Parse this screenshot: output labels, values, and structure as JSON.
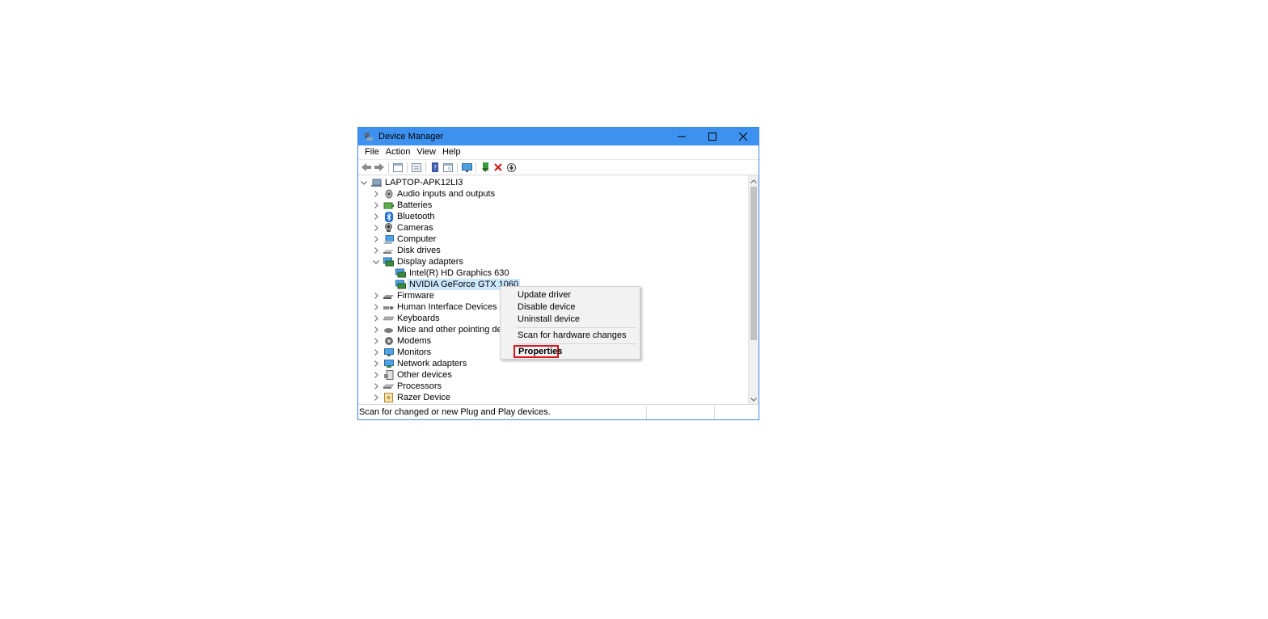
{
  "window": {
    "title": "Device Manager"
  },
  "menubar": {
    "items": [
      "File",
      "Action",
      "View",
      "Help"
    ]
  },
  "tree": {
    "root": "LAPTOP-APK12LI3",
    "categories": [
      "Audio inputs and outputs",
      "Batteries",
      "Bluetooth",
      "Cameras",
      "Computer",
      "Disk drives",
      "Display adapters",
      "Intel(R) HD Graphics 630",
      "NVIDIA GeForce GTX 1060",
      "Firmware",
      "Human Interface Devices",
      "Keyboards",
      "Mice and other pointing devices",
      "Modems",
      "Monitors",
      "Network adapters",
      "Other devices",
      "Processors",
      "Razer Device"
    ],
    "expanded": "Display adapters",
    "selected": "NVIDIA GeForce GTX 1060"
  },
  "context_menu": {
    "update": "Update driver",
    "disable": "Disable device",
    "uninstall": "Uninstall device",
    "scan": "Scan for hardware changes",
    "properties": "Properties"
  },
  "status": {
    "text": "Scan for changed or new Plug and Play devices."
  },
  "colors": {
    "titlebar": "#3d92f0",
    "selection": "#cce8ff",
    "highlight_box": "#e0141e"
  }
}
